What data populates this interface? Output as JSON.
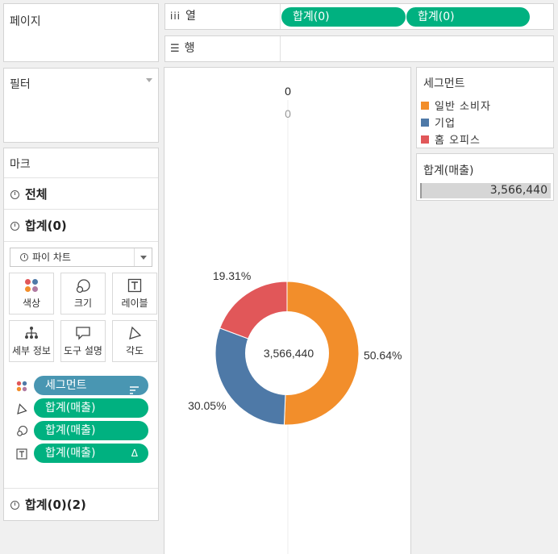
{
  "pages": {
    "title": "페이지"
  },
  "filters": {
    "title": "필터"
  },
  "shelves": {
    "columns": {
      "label": "열",
      "pills": [
        "합계(0)",
        "합계(0)"
      ]
    },
    "rows": {
      "label": "행"
    }
  },
  "marks": {
    "title": "마크",
    "all_label": "전체",
    "card1_label": "합계(0)",
    "card2_label": "합계(0)(2)",
    "mark_type": "파이 차트",
    "buttons": {
      "color": "색상",
      "size": "크기",
      "label": "레이블",
      "detail": "세부 정보",
      "tooltip": "도구 설명",
      "angle": "각도"
    },
    "fields": [
      {
        "label": "세그먼트",
        "kind": "dimension"
      },
      {
        "label": "합계(매출)",
        "kind": "measure"
      },
      {
        "label": "합계(매출)",
        "kind": "measure"
      },
      {
        "label": "합계(매출)",
        "kind": "measure",
        "flag": "Δ"
      }
    ]
  },
  "legend": {
    "title": "세그먼트",
    "items": [
      {
        "label": "일반 소비자",
        "color": "#f28e2b"
      },
      {
        "label": "기업",
        "color": "#4e79a7"
      },
      {
        "label": "홈 오피스",
        "color": "#e15759"
      }
    ]
  },
  "size_legend": {
    "title": "합계(매출)",
    "value": "3,566,440"
  },
  "view": {
    "header_bold": "0",
    "header_light": "0",
    "center_label": "3,566,440"
  },
  "chart_data": {
    "type": "pie",
    "categories": [
      "일반 소비자",
      "기업",
      "홈 오피스"
    ],
    "values": [
      50.64,
      30.05,
      19.31
    ],
    "labels": [
      "50.64%",
      "30.05%",
      "19.31%"
    ],
    "colors": [
      "#f28e2b",
      "#4e79a7",
      "#e15759"
    ],
    "total": "3,566,440",
    "donut": true
  }
}
